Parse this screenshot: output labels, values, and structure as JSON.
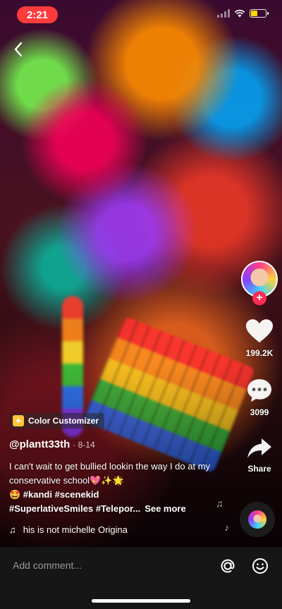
{
  "status_bar": {
    "time": "2:21"
  },
  "creator": {
    "follow_symbol": "+"
  },
  "actions": {
    "likes": "199.2K",
    "comments": "3099",
    "share": "Share"
  },
  "effect": {
    "name": "Color Customizer"
  },
  "post": {
    "author": "@plantt33th",
    "date": "· 8-14",
    "caption_text": "I can't wait to get bullied lookin the way I do at my conservative school💖✨🌟",
    "hashtags_line1": "🤩 #kandi #scenekid",
    "hashtags_line2": "#SuperlativeSmiles #Telepor...",
    "see_more": "See more"
  },
  "sound": {
    "title": "his is not michelle Origina"
  },
  "comment_bar": {
    "placeholder": "Add comment..."
  },
  "colors": {
    "accent": "#fe2c55",
    "time_badge": "#ff3b3b"
  }
}
